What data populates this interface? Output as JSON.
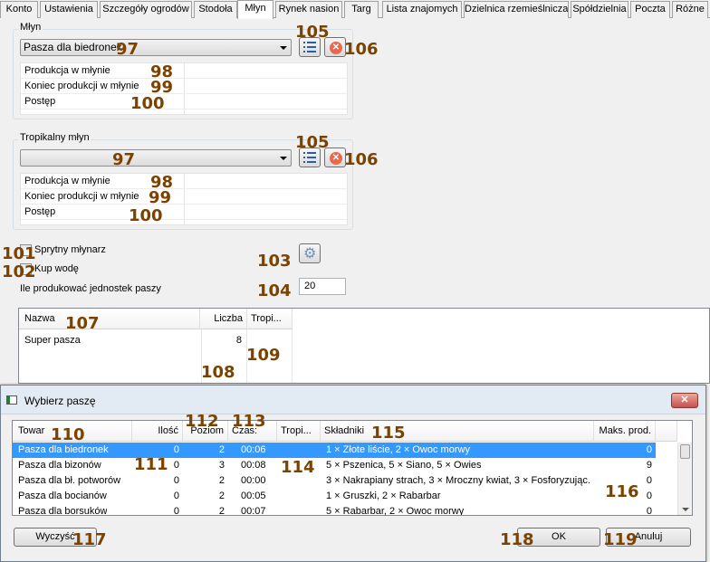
{
  "tabs": [
    {
      "label": "Konto",
      "active": false
    },
    {
      "label": "Ustawienia",
      "active": false
    },
    {
      "label": "Szczegóły ogrodów",
      "active": false
    },
    {
      "label": "Stodoła",
      "active": false
    },
    {
      "label": "Młyn",
      "active": true
    },
    {
      "label": "Rynek nasion",
      "active": false
    },
    {
      "label": "Targ",
      "active": false
    },
    {
      "label": "Lista znajomych",
      "active": false
    },
    {
      "label": "Dzielnica rzemieślnicza",
      "active": false
    },
    {
      "label": "Spółdzielnia",
      "active": false
    },
    {
      "label": "Poczta",
      "active": false
    },
    {
      "label": "Różne",
      "active": false
    }
  ],
  "mill": {
    "title": "Młyn",
    "selected_feed": "Pasza dla biedronek",
    "rows": [
      "Produkcja w młynie",
      "Koniec produkcji w młynie",
      "Postęp"
    ]
  },
  "tropical_mill": {
    "title": "Tropikalny młyn",
    "selected_feed": "",
    "rows": [
      "Produkcja w młynie",
      "Koniec produkcji w młynie",
      "Postęp"
    ]
  },
  "options": {
    "smart_miller": "Sprytny młynarz",
    "buy_water": "Kup wodę",
    "units_label": "Ile produkować jednostek paszy",
    "units_value": "20"
  },
  "feed_grid": {
    "headers": [
      "Nazwa",
      "Liczba",
      "Tropi..."
    ],
    "rows": [
      {
        "name": "Super pasza",
        "count": "8",
        "tropi": ""
      }
    ]
  },
  "dialog": {
    "title": "Wybierz paszę",
    "headers": [
      "Towar",
      "Ilość",
      "Poziom",
      "Czas:",
      "Tropi...",
      "Składniki",
      "Maks. prod."
    ],
    "rows": [
      {
        "name": "Pasza dla biedronek",
        "qty": "0",
        "level": "2",
        "time": "00:06",
        "tropi": "",
        "ingredients": "1 × Złote liście, 2 × Owoc morwy",
        "max": "0",
        "selected": true
      },
      {
        "name": "Pasza dla bizonów",
        "qty": "0",
        "level": "3",
        "time": "00:08",
        "tropi": "",
        "ingredients": "5 × Pszenica, 5 × Siano, 5 × Owies",
        "max": "9",
        "selected": false
      },
      {
        "name": "Pasza dla bł. potworów",
        "qty": "0",
        "level": "2",
        "time": "00:00",
        "tropi": "",
        "ingredients": "3 × Nakrapiany strach, 3 × Mroczny kwiat, 3 × Fosforyzując...",
        "max": "0",
        "selected": false
      },
      {
        "name": "Pasza dla bocianów",
        "qty": "0",
        "level": "2",
        "time": "00:05",
        "tropi": "",
        "ingredients": "1 × Gruszki, 2 × Rabarbar",
        "max": "0",
        "selected": false
      },
      {
        "name": "Pasza dla borsuków",
        "qty": "0",
        "level": "2",
        "time": "00:07",
        "tropi": "",
        "ingredients": "5 × Rabarbar, 2 × Owoc morwy",
        "max": "0",
        "selected": false
      }
    ],
    "clear_label": "Wyczyść",
    "ok_label": "OK",
    "cancel_label": "Anuluj"
  },
  "markers": {
    "m97": "97",
    "m98": "98",
    "m99": "99",
    "m100": "100",
    "m101": "101",
    "m102": "102",
    "m103": "103",
    "m104": "104",
    "m105": "105",
    "m106": "106",
    "m107": "107",
    "m108": "108",
    "m109": "109",
    "m110": "110",
    "m111": "111",
    "m112": "112",
    "m113": "113",
    "m114": "114",
    "m115": "115",
    "m116": "116",
    "m117": "117",
    "m118": "118",
    "m119": "119"
  },
  "icons": {
    "list": "list-icon",
    "remove": "remove-icon",
    "gear": "gear-icon",
    "close": "close-icon",
    "window": "window-icon"
  },
  "colors": {
    "accent": "#3399ff",
    "marker": "#7b4200",
    "close_red": "#c75050"
  }
}
